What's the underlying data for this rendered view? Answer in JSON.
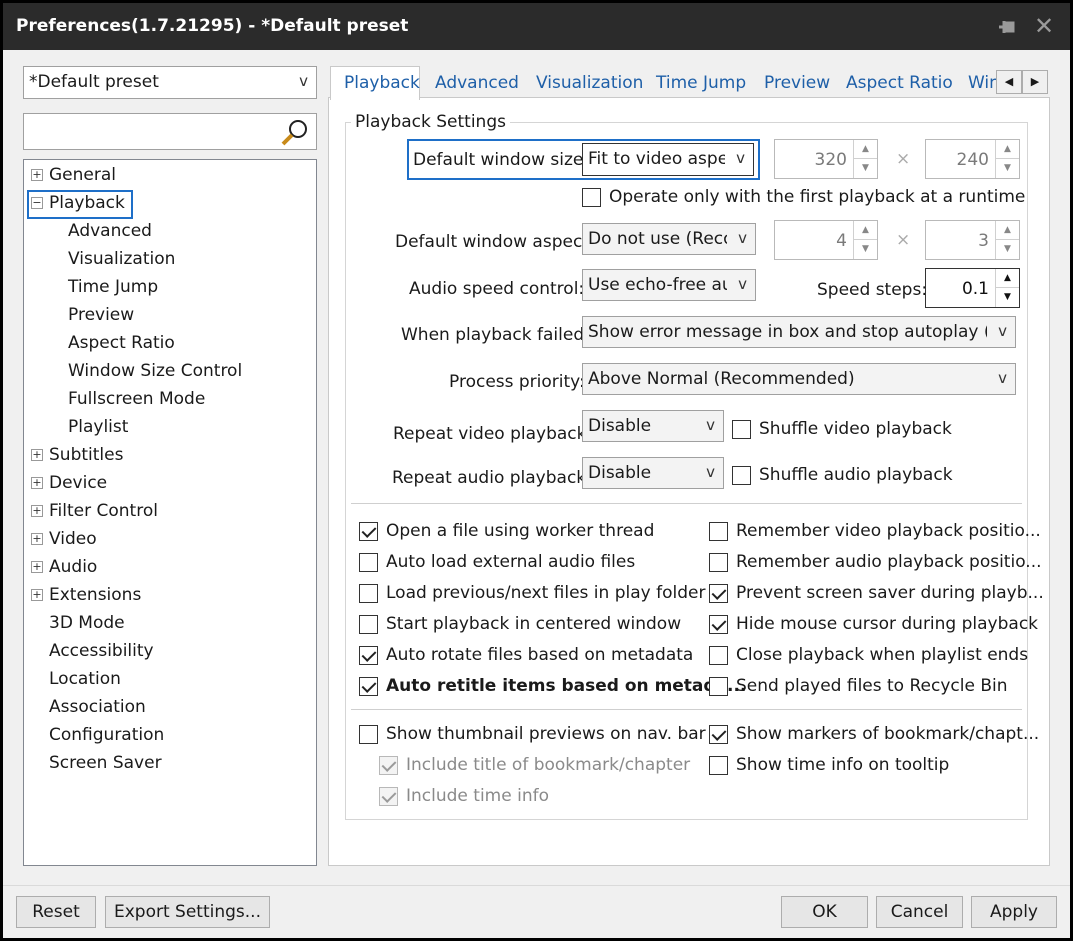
{
  "window": {
    "title": "Preferences(1.7.21295) - *Default preset"
  },
  "preset": {
    "value": "*Default preset"
  },
  "search": {
    "placeholder": ""
  },
  "tree": [
    {
      "label": "General",
      "expander": "+"
    },
    {
      "label": "Playback",
      "expander": "−"
    },
    {
      "label": "Advanced"
    },
    {
      "label": "Visualization"
    },
    {
      "label": "Time Jump"
    },
    {
      "label": "Preview"
    },
    {
      "label": "Aspect Ratio"
    },
    {
      "label": "Window Size Control"
    },
    {
      "label": "Fullscreen Mode"
    },
    {
      "label": "Playlist"
    },
    {
      "label": "Subtitles",
      "expander": "+"
    },
    {
      "label": "Device",
      "expander": "+"
    },
    {
      "label": "Filter Control",
      "expander": "+"
    },
    {
      "label": "Video",
      "expander": "+"
    },
    {
      "label": "Audio",
      "expander": "+"
    },
    {
      "label": "Extensions",
      "expander": "+"
    },
    {
      "label": "3D Mode"
    },
    {
      "label": "Accessibility"
    },
    {
      "label": "Location"
    },
    {
      "label": "Association"
    },
    {
      "label": "Configuration"
    },
    {
      "label": "Screen Saver"
    }
  ],
  "tabs": [
    "Playback",
    "Advanced",
    "Visualization",
    "Time Jump",
    "Preview",
    "Aspect Ratio",
    "Win"
  ],
  "tab_scroll": {
    "left": "◀",
    "right": "▶"
  },
  "group": {
    "title": "Playback Settings"
  },
  "settings": {
    "window_size_label": "Default window size:",
    "window_size_value": "Fit to video aspect",
    "width": "320",
    "height": "240",
    "times": "×",
    "operate_first": "Operate only with the first playback at a runtime",
    "aspect_label": "Default window aspect",
    "aspect_value": "Do not use (Recommended)",
    "aspect_w": "4",
    "aspect_h": "3",
    "audio_speed_label": "Audio speed control:",
    "audio_speed_value": "Use echo-free audio",
    "speed_steps_label": "Speed steps:",
    "speed_steps_value": "0.1",
    "failed_label": "When playback failed:",
    "failed_value": "Show error message in box and stop autoplay (Recommended)",
    "priority_label": "Process priority:",
    "priority_value": "Above Normal (Recommended)",
    "repeat_video_label": "Repeat video playback:",
    "repeat_video_value": "Disable",
    "shuffle_video": "Shuffle video playback",
    "repeat_audio_label": "Repeat audio playback:",
    "repeat_audio_value": "Disable",
    "shuffle_audio": "Shuffle audio playback"
  },
  "checks_left": [
    {
      "label": "Open a file using worker thread",
      "checked": true
    },
    {
      "label": "Auto load external audio files",
      "checked": false
    },
    {
      "label": "Load previous/next files in play folder",
      "checked": false
    },
    {
      "label": "Start playback in centered window",
      "checked": false
    },
    {
      "label": "Auto rotate files based on metadata",
      "checked": true
    },
    {
      "label": "Auto retitle items based on metada...",
      "checked": true
    }
  ],
  "checks_right": [
    {
      "label": "Remember video playback positio...",
      "checked": false
    },
    {
      "label": "Remember audio playback positio...",
      "checked": false
    },
    {
      "label": "Prevent screen saver during playb...",
      "checked": true
    },
    {
      "label": "Hide mouse cursor during playback",
      "checked": true
    },
    {
      "label": "Close playback when playlist ends",
      "checked": false
    },
    {
      "label": "Send played files to Recycle Bin",
      "checked": false
    }
  ],
  "checks_bottom": {
    "thumbnail": {
      "label": "Show thumbnail previews on nav. bar",
      "checked": false
    },
    "include_title": {
      "label": "Include title of bookmark/chapter",
      "checked": true
    },
    "include_time": {
      "label": "Include time info",
      "checked": true
    },
    "markers": {
      "label": "Show markers of bookmark/chapt...",
      "checked": true
    },
    "time_tooltip": {
      "label": "Show time info on tooltip",
      "checked": false
    }
  },
  "buttons": {
    "reset": "Reset",
    "export": "Export Settings...",
    "ok": "OK",
    "cancel": "Cancel",
    "apply": "Apply"
  },
  "accent": "#1e6fc8",
  "titlebar_color": "#2b2b2b"
}
